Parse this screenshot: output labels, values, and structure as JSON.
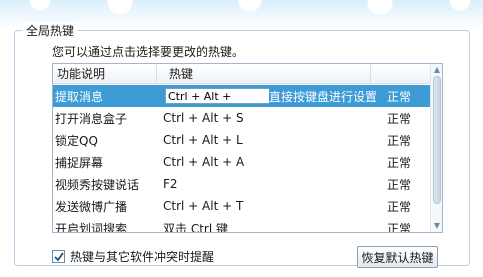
{
  "group": {
    "title": "全局热键"
  },
  "hint": "您可以通过点击选择要更改的热键。",
  "list": {
    "columns": {
      "name": "功能说明",
      "key": "热键"
    },
    "rows": [
      {
        "name": "提取消息",
        "key": "Ctrl + Alt + ",
        "desc": "直接按键盘进行设置",
        "status": "正常",
        "selected": true
      },
      {
        "name": "打开消息盒子",
        "key": "Ctrl + Alt + S",
        "desc": "",
        "status": "正常"
      },
      {
        "name": "锁定QQ",
        "key": "Ctrl + Alt + L",
        "desc": "",
        "status": "正常"
      },
      {
        "name": "捕捉屏幕",
        "key": "Ctrl + Alt + A",
        "desc": "",
        "status": "正常"
      },
      {
        "name": "视频秀按键说话",
        "key": "F2",
        "desc": "",
        "status": "正常"
      },
      {
        "name": "发送微博广播",
        "key": "Ctrl + Alt + T",
        "desc": "",
        "status": "正常"
      },
      {
        "name": "开启划词搜索",
        "key": "双击 Ctrl 键",
        "desc": "",
        "status": "正常"
      }
    ]
  },
  "conflict_check": {
    "label": "热键与其它软件冲突时提醒",
    "checked": true
  },
  "restore_button": "恢复默认热键",
  "colors": {
    "selected_row": "#3d9bd6",
    "border": "#9fb6cd"
  },
  "icons": {
    "scroll_up": "scroll-up-arrow-icon",
    "scroll_down": "scroll-down-arrow-icon",
    "check": "checkmark-icon"
  }
}
